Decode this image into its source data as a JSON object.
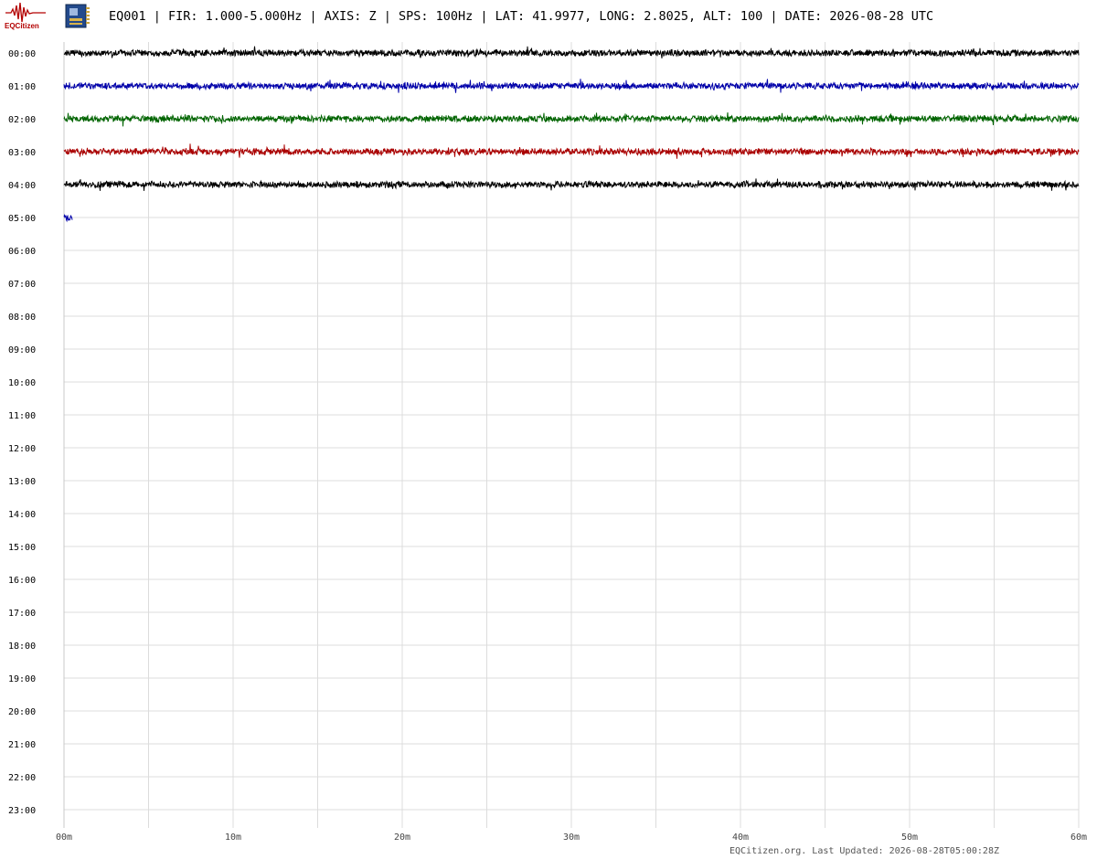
{
  "header": {
    "title": "EQ001 | FIR: 1.000-5.000Hz | AXIS: Z | SPS: 100Hz | LAT: 41.9977, LONG: 2.8025, ALT: 100 | DATE: 2026-08-28 UTC",
    "logo_text": "EQCitizen",
    "logo_icon": "seismogram-icon",
    "sensor_icon": "circuit-board-icon"
  },
  "footer": {
    "text": "EQCitizen.org. Last Updated: 2026-08-28T05:00:28Z"
  },
  "colors": {
    "grid": "#dcdcdc",
    "trace_cycle": [
      "#000000",
      "#0000aa",
      "#006400",
      "#aa0000"
    ],
    "logo": "#b30000"
  },
  "chart_data": {
    "type": "line",
    "subtype": "helicorder",
    "title": "EQ001 | FIR: 1.000-5.000Hz | AXIS: Z | SPS: 100Hz | LAT: 41.9977, LONG: 2.8025, ALT: 100 | DATE: 2026-08-28 UTC",
    "xlabel": "",
    "ylabel": "",
    "x_unit": "minutes",
    "xlim": [
      0,
      60
    ],
    "x_ticks": [
      0,
      10,
      20,
      30,
      40,
      50,
      60
    ],
    "x_tick_labels": [
      "00m",
      "10m",
      "20m",
      "30m",
      "40m",
      "50m",
      "60m"
    ],
    "x_minor_gridlines_every": 5,
    "rows": [
      "00:00",
      "01:00",
      "02:00",
      "03:00",
      "04:00",
      "05:00",
      "06:00",
      "07:00",
      "08:00",
      "09:00",
      "10:00",
      "11:00",
      "12:00",
      "13:00",
      "14:00",
      "15:00",
      "16:00",
      "17:00",
      "18:00",
      "19:00",
      "20:00",
      "21:00",
      "22:00",
      "23:00"
    ],
    "grid": true,
    "series": [
      {
        "row": "00:00",
        "color": "#000000",
        "data_end_minute": 60,
        "amplitude": "low-noise"
      },
      {
        "row": "01:00",
        "color": "#0000aa",
        "data_end_minute": 60,
        "amplitude": "low-noise"
      },
      {
        "row": "02:00",
        "color": "#006400",
        "data_end_minute": 60,
        "amplitude": "low-noise"
      },
      {
        "row": "03:00",
        "color": "#aa0000",
        "data_end_minute": 60,
        "amplitude": "low-noise"
      },
      {
        "row": "04:00",
        "color": "#000000",
        "data_end_minute": 60,
        "amplitude": "low-noise"
      },
      {
        "row": "05:00",
        "color": "#0000aa",
        "data_end_minute": 0.5,
        "amplitude": "low-noise"
      }
    ]
  }
}
